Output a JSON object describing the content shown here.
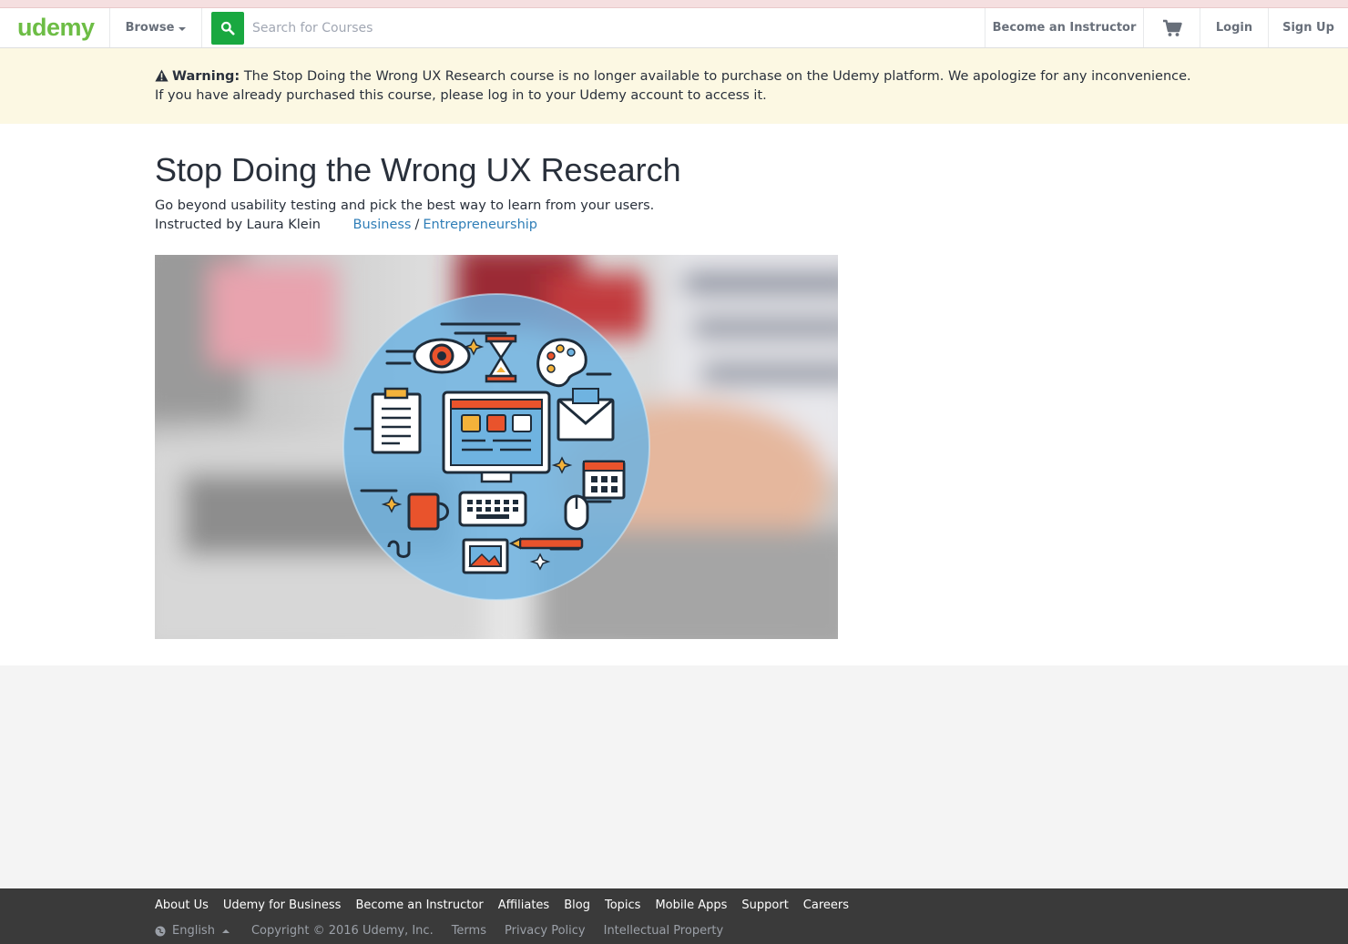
{
  "header": {
    "logo": "udemy",
    "browse_label": "Browse",
    "search_placeholder": "Search for Courses",
    "become_instructor": "Become an Instructor",
    "login": "Login",
    "signup": "Sign Up"
  },
  "warning": {
    "label": "Warning:",
    "message": "The Stop Doing the Wrong UX Research course is no longer available to purchase on the Udemy platform. We apologize for any inconvenience. If you have already purchased this course, please log in to your Udemy account to access it."
  },
  "course": {
    "title": "Stop Doing the Wrong UX Research",
    "subtitle": "Go beyond usability testing and pick the best way to learn from your users.",
    "instructor": "Instructed by Laura Klein",
    "category": "Business",
    "separator": "/",
    "subcategory": "Entrepreneurship"
  },
  "footer": {
    "links": [
      "About Us",
      "Udemy for Business",
      "Become an Instructor",
      "Affiliates",
      "Blog",
      "Topics",
      "Mobile Apps",
      "Support",
      "Careers"
    ],
    "language": "English",
    "copyright": "Copyright © 2016 Udemy, Inc.",
    "terms": "Terms",
    "privacy": "Privacy Policy",
    "ip": "Intellectual Property"
  },
  "colors": {
    "brand_green": "#6dbd45",
    "search_button": "#19a840",
    "warning_bg": "#fcf8e3",
    "link_blue": "#2f7eb7",
    "footer_bg": "#3a3a3a"
  },
  "icons": {
    "search": "search-icon",
    "cart": "cart-icon",
    "warning": "warning-icon",
    "globe": "globe-icon"
  }
}
